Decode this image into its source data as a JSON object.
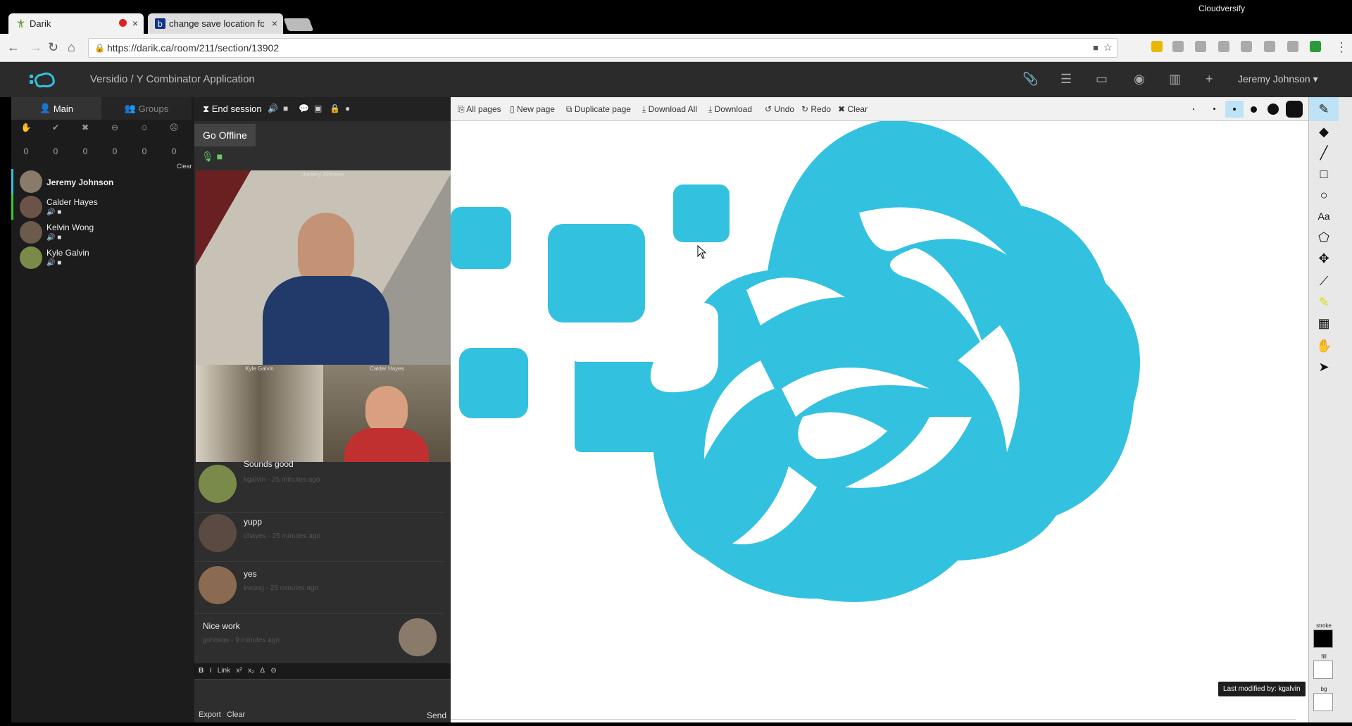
{
  "browser": {
    "tabs": [
      {
        "title": "Darik"
      },
      {
        "title": "change save location for"
      }
    ],
    "profile": "Cloudversify",
    "url": "https://darik.ca/room/211/section/13902"
  },
  "header": {
    "breadcrumb": "Versidio / Y Combinator Application",
    "user": "Jeremy Johnson"
  },
  "left": {
    "tabs": {
      "main": "Main",
      "groups": "Groups"
    },
    "counts": [
      "0",
      "0",
      "0",
      "0",
      "0",
      "0"
    ],
    "clear": "Clear",
    "participants": [
      {
        "name": "Jeremy Johnson"
      },
      {
        "name": "Calder Hayes"
      },
      {
        "name": "Kelvin Wong"
      },
      {
        "name": "Kyle Galvin"
      }
    ]
  },
  "mid": {
    "end_session": "End session",
    "go_offline": "Go Offline",
    "videos": [
      {
        "label": "Jeremy Johnson"
      },
      {
        "label": "Kyle Galvin"
      },
      {
        "label": "Calder Hayes"
      }
    ],
    "messages": [
      {
        "text": "Sounds good",
        "meta": "kgalvin - 25 minutes ago"
      },
      {
        "text": "yupp",
        "meta": "chayes - 25 minutes ago"
      },
      {
        "text": "yes",
        "meta": "kwong - 25 minutes ago"
      },
      {
        "text": "Nice work",
        "meta": "jjohnson - 9 minutes ago"
      }
    ],
    "format": {
      "bold": "B",
      "italic": "I",
      "link": "Link",
      "sup": "x²",
      "sub": "x₂",
      "delta": "Δ",
      "circle": "⊝"
    },
    "footer": {
      "export": "Export",
      "clear": "Clear",
      "send": "Send"
    }
  },
  "whiteboard": {
    "toolbar": {
      "all_pages": "All pages",
      "new_page": "New page",
      "duplicate_page": "Duplicate page",
      "download_all": "Download All",
      "download": "Download",
      "undo": "Undo",
      "redo": "Redo",
      "clear": "Clear"
    },
    "last_modified": "Last modified by: kgalvin",
    "brand_color": "#33c1e0"
  },
  "rail": {
    "stroke": "stroke",
    "fill": "fill",
    "bg": "bg"
  }
}
